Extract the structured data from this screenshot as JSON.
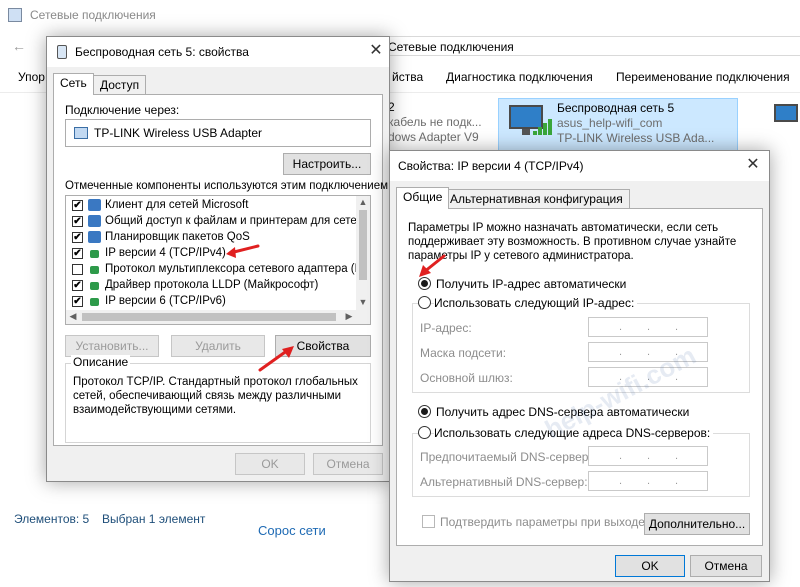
{
  "explorer": {
    "title": "Сетевые подключения",
    "address_crumb": "Сетевые подключения",
    "toolbar": {
      "organize_partial": "Упор",
      "properties_partial": "йства",
      "diagnostics": "Диагностика подключения",
      "rename": "Переименование подключения"
    },
    "connections": [
      {
        "name": "2",
        "line2": "кабель не подк...",
        "line3": "dows Adapter V9"
      },
      {
        "name": "Беспроводная сеть 5",
        "line2": "asus_help-wifi_com",
        "line3": "TP-LINK Wireless USB Ada..."
      }
    ],
    "status": {
      "count": "Элементов: 5",
      "selected": "Выбран 1 элемент"
    },
    "bottom_link": "Сорос сети",
    "watermark": "help-wifi.com"
  },
  "wireless_dialog": {
    "title": "Беспроводная сеть 5: свойства",
    "tabs": [
      "Сеть",
      "Доступ"
    ],
    "connect_through_label": "Подключение через:",
    "adapter_name": "TP-LINK Wireless USB Adapter",
    "configure_button": "Настроить...",
    "components_label": "Отмеченные компоненты используются этим подключением:",
    "components": [
      {
        "name": "Клиент для сетей Microsoft",
        "checked": true,
        "icon_color": "#3a78c2"
      },
      {
        "name": "Общий доступ к файлам и принтерам для сетей Mi",
        "checked": true,
        "icon_color": "#3a78c2"
      },
      {
        "name": "Планировщик пакетов QoS",
        "checked": true,
        "icon_color": "#3a78c2"
      },
      {
        "name": "IP версии 4 (TCP/IPv4)",
        "checked": true,
        "icon_color": "#2d9a4a"
      },
      {
        "name": "Протокол мультиплексора сетевого адаптера (Май",
        "checked": false,
        "icon_color": "#2d9a4a"
      },
      {
        "name": "Драйвер протокола LLDP (Майкрософт)",
        "checked": true,
        "icon_color": "#2d9a4a"
      },
      {
        "name": "IP версии 6 (TCP/IPv6)",
        "checked": true,
        "icon_color": "#2d9a4a"
      }
    ],
    "install_button": "Установить...",
    "remove_button": "Удалить",
    "properties_button": "Свойства",
    "description_label": "Описание",
    "description_text": "Протокол TCP/IP. Стандартный протокол глобальных сетей, обеспечивающий связь между различными взаимодействующими сетями.",
    "ok_button": "OK",
    "cancel_button": "Отмена"
  },
  "ipv4_dialog": {
    "title": "Свойства: IP версии 4 (TCP/IPv4)",
    "tabs": [
      "Общие",
      "Альтернативная конфигурация"
    ],
    "intro": "Параметры IP можно назначать автоматически, если сеть поддерживает эту возможность. В противном случае узнайте параметры IP у сетевого администратора.",
    "auto_ip": "Получить IP-адрес автоматически",
    "manual_ip": "Использовать следующий IP-адрес:",
    "ip_address_label": "IP-адрес:",
    "subnet_label": "Маска подсети:",
    "gateway_label": "Основной шлюз:",
    "auto_dns": "Получить адрес DNS-сервера автоматически",
    "manual_dns": "Использовать следующие адреса DNS-серверов:",
    "preferred_dns_label": "Предпочитаемый DNS-сервер:",
    "alternate_dns_label": "Альтернативный DNS-сервер:",
    "ip_placeholder_dots": ".      .      .",
    "validate_on_exit": "Подтвердить параметры при выходе",
    "advanced_button": "Дополнительно...",
    "ok_button": "OK",
    "cancel_button": "Отмена",
    "auto_ip_selected": true,
    "auto_dns_selected": true
  },
  "colors": {
    "selection": "#cce8ff",
    "accent": "#0078d7",
    "arrow": "#e02020"
  }
}
